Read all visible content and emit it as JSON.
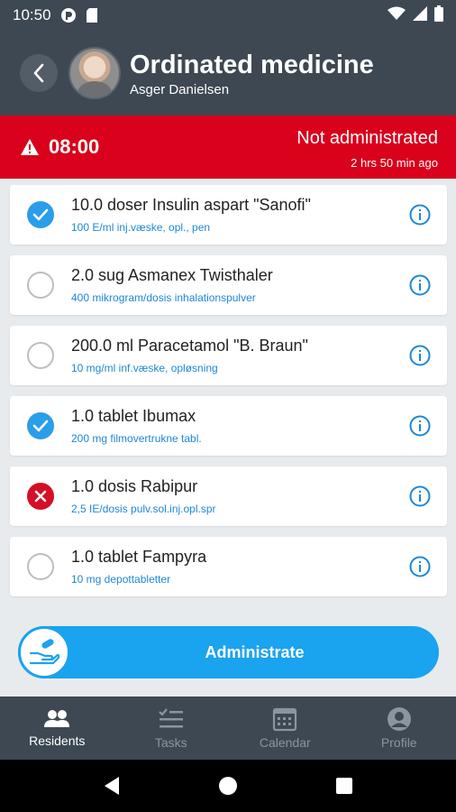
{
  "status_bar": {
    "time": "10:50"
  },
  "header": {
    "title": "Ordinated medicine",
    "resident_name": "Asger Danielsen"
  },
  "alert": {
    "time": "08:00",
    "status": "Not administrated",
    "elapsed": "2 hrs 50 min ago",
    "color": "#d9011b"
  },
  "medications": [
    {
      "name": "10.0 doser Insulin aspart \"Sanofi\"",
      "description": "100 E/ml inj.væske, opl., pen",
      "state": "checked"
    },
    {
      "name": "2.0 sug Asmanex Twisthaler",
      "description": "400 mikrogram/dosis inhalationspulver",
      "state": "empty"
    },
    {
      "name": "200.0 ml Paracetamol \"B. Braun\"",
      "description": "10 mg/ml inf.væske, opløsning",
      "state": "empty"
    },
    {
      "name": "1.0 tablet Ibumax",
      "description": "200 mg filmovertrukne tabl.",
      "state": "checked"
    },
    {
      "name": "1.0 dosis Rabipur",
      "description": "2,5 IE/dosis pulv.sol.inj.opl.spr",
      "state": "refused"
    },
    {
      "name": "1.0 tablet Fampyra",
      "description": "10 mg depottabletter",
      "state": "empty"
    }
  ],
  "action": {
    "administrate_label": "Administrate",
    "color": "#1aa3ef"
  },
  "nav": [
    {
      "label": "Residents",
      "icon": "people-icon",
      "active": true
    },
    {
      "label": "Tasks",
      "icon": "checklist-icon",
      "active": false
    },
    {
      "label": "Calendar",
      "icon": "calendar-icon",
      "active": false
    },
    {
      "label": "Profile",
      "icon": "profile-icon",
      "active": false
    }
  ],
  "colors": {
    "header_bg": "#3d4852",
    "accent": "#2a9ee8",
    "refused": "#d40f26"
  }
}
